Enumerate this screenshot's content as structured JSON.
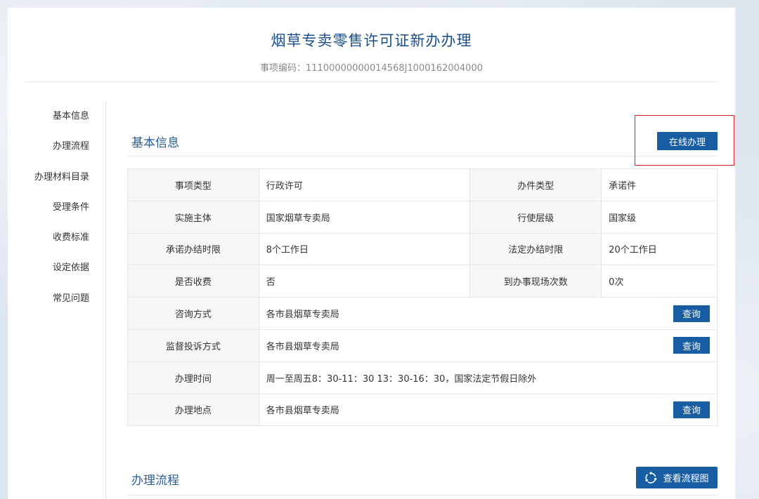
{
  "header": {
    "title": "烟草专卖零售许可证新办办理",
    "code_label": "事项编码：",
    "code_value": "11100000000014568J1000162004000"
  },
  "sidebar": {
    "items": [
      {
        "label": "基本信息"
      },
      {
        "label": "办理流程"
      },
      {
        "label": "办理材料目录"
      },
      {
        "label": "受理条件"
      },
      {
        "label": "收费标准"
      },
      {
        "label": "设定依据"
      },
      {
        "label": "常见问题"
      }
    ]
  },
  "basic_info": {
    "section_title": "基本信息",
    "online_button": "在线办理",
    "rows": [
      {
        "label1": "事项类型",
        "value1": "行政许可",
        "label2": "办件类型",
        "value2": "承诺件"
      },
      {
        "label1": "实施主体",
        "value1": "国家烟草专卖局",
        "label2": "行使层级",
        "value2": "国家级"
      },
      {
        "label1": "承诺办结时限",
        "value1": "8个工作日",
        "label2": "法定办结时限",
        "value2": "20个工作日"
      },
      {
        "label1": "是否收费",
        "value1": "否",
        "label2": "到办事现场次数",
        "value2": "0次"
      }
    ],
    "wide_rows": [
      {
        "label": "咨询方式",
        "value": "各市县烟草专卖局",
        "button": "查询"
      },
      {
        "label": "监督投诉方式",
        "value": "各市县烟草专卖局",
        "button": "查询"
      },
      {
        "label": "办理时间",
        "value": "周一至周五8：30-11：30 13：30-16：30，国家法定节假日除外",
        "button": ""
      },
      {
        "label": "办理地点",
        "value": "各市县烟草专卖局",
        "button": "查询"
      }
    ]
  },
  "process": {
    "section_title": "办理流程",
    "flow_button": "查看流程图",
    "flow_icon": "refresh-cycle-icon"
  },
  "colors": {
    "accent": "#185da3",
    "title": "#1a4f8b",
    "highlight": "#e02020"
  }
}
